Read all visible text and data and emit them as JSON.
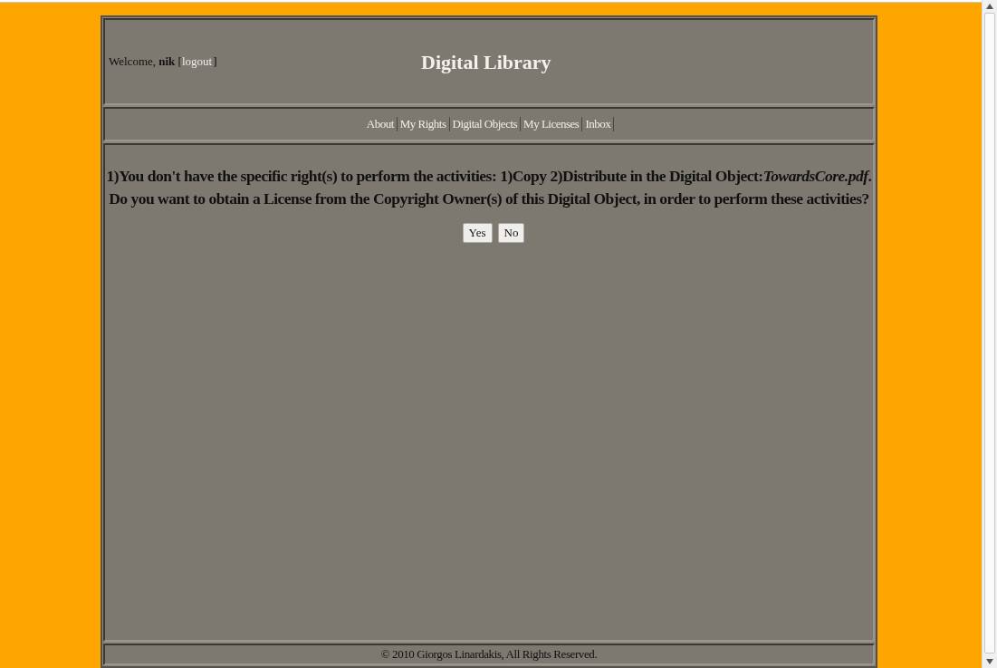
{
  "header": {
    "welcome": {
      "prefix": "Welcome, **nik** [",
      "link": "logout",
      "suffix": "]"
    },
    "title": "Digital Library"
  },
  "nav": [
    {
      "label": "About"
    },
    {
      "label": "My Rights"
    },
    {
      "label": "Digital Objects"
    },
    {
      "label": "My Licenses"
    },
    {
      "label": "Inbox"
    }
  ],
  "message": {
    "lines": [
      "1)You don't have the specific right(s) to perform the activities: 1)Copy 2)Distribute in the Digital Object:*TowardsCore.pdf*.",
      "Do you want to obtain a License from the Copyright Owner(s) of this Digital Object, in order to perform these activities?"
    ],
    "buttons": [
      "Yes",
      "No"
    ]
  },
  "footer": "© 2010 Giorgos Linardakis, All Rights Reserved."
}
